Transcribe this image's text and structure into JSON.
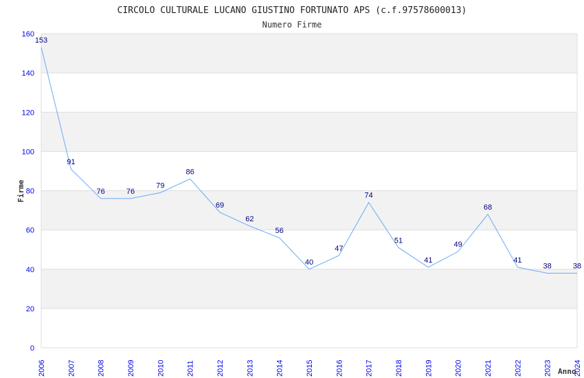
{
  "chart_data": {
    "type": "line",
    "title": "CIRCOLO CULTURALE LUCANO GIUSTINO FORTUNATO APS (c.f.97578600013)",
    "subtitle": "Numero Firme",
    "xlabel": "Anno",
    "ylabel": "Firme",
    "ylim": [
      0,
      160
    ],
    "yticks": [
      0,
      20,
      40,
      60,
      80,
      100,
      120,
      140,
      160
    ],
    "grid": true,
    "categories": [
      "2006",
      "2007",
      "2008",
      "2009",
      "2010",
      "2011",
      "2012",
      "2013",
      "2014",
      "2015",
      "2016",
      "2017",
      "2018",
      "2019",
      "2020",
      "2021",
      "2022",
      "2023",
      "2024"
    ],
    "values": [
      153,
      91,
      76,
      76,
      79,
      86,
      69,
      62,
      56,
      40,
      47,
      74,
      51,
      41,
      49,
      68,
      41,
      38,
      38
    ],
    "colors": {
      "line": "#6aaaf0",
      "band": "#f2f2f2",
      "tick": "#0000ee",
      "label": "#000080"
    }
  }
}
